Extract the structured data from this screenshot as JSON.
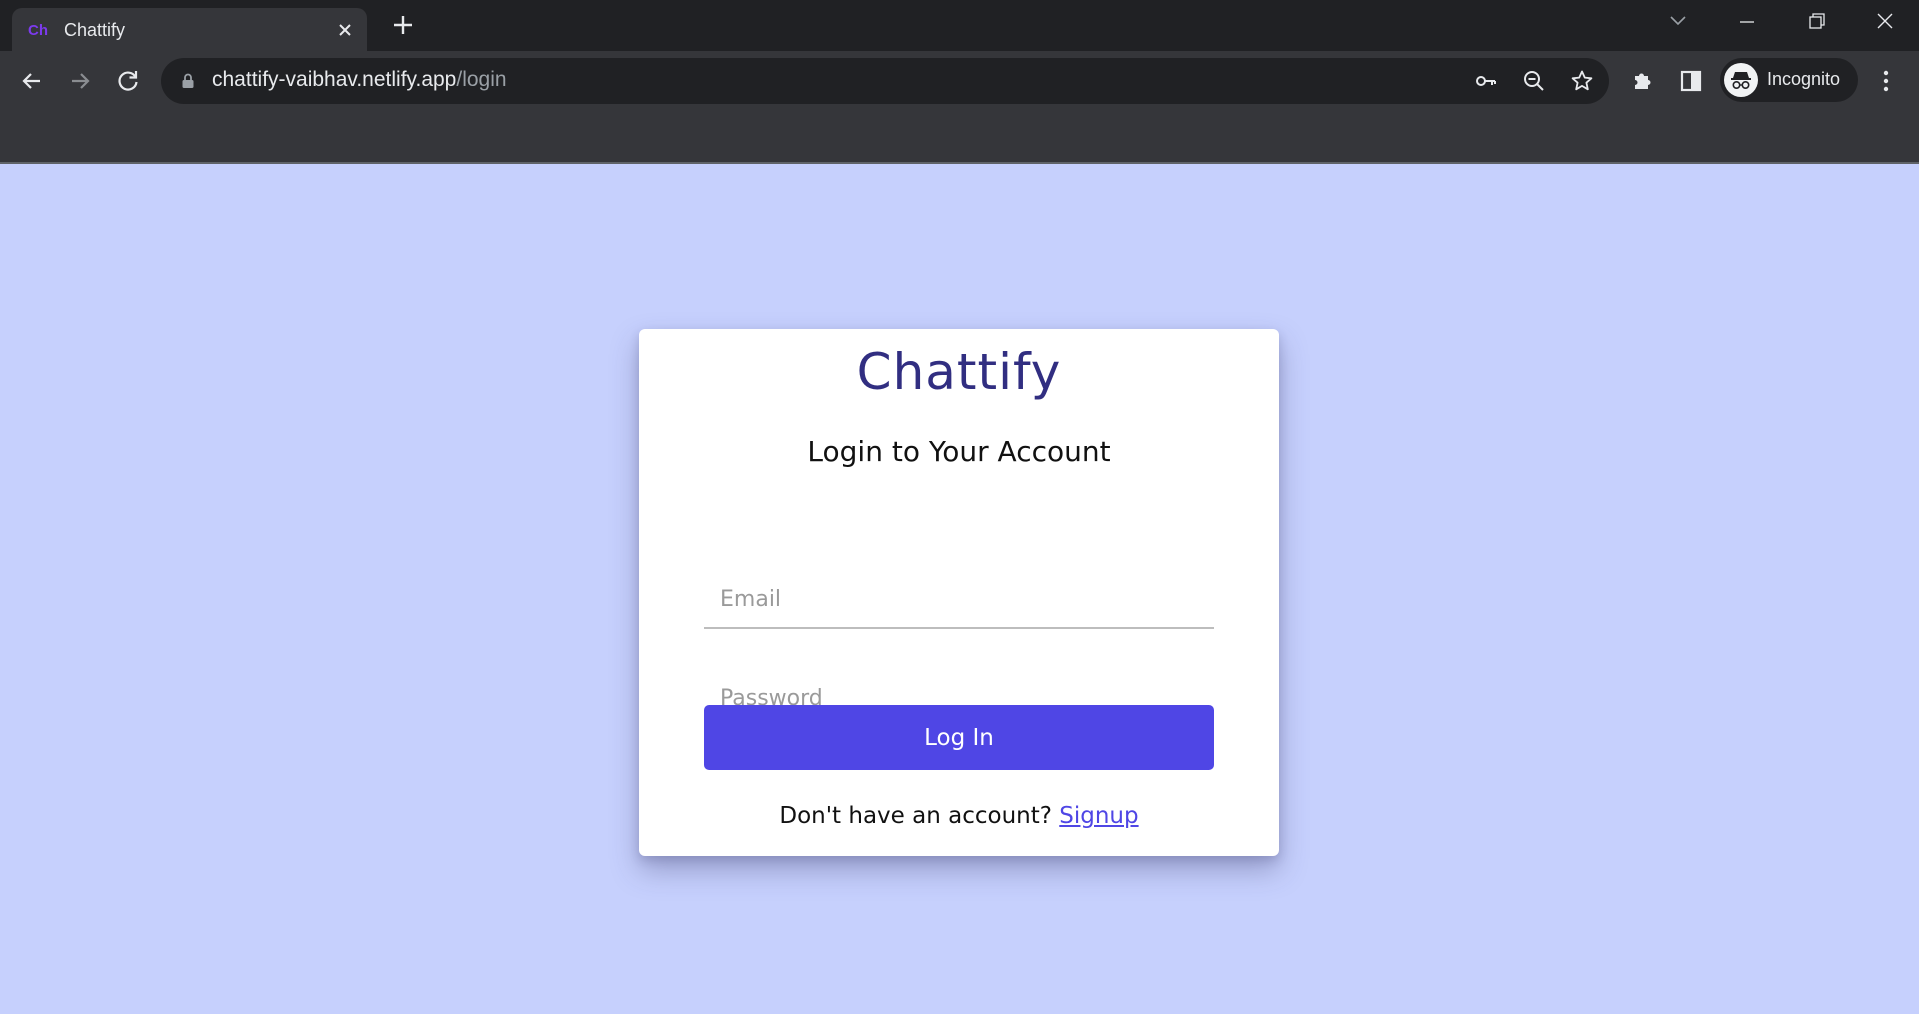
{
  "browser": {
    "tab": {
      "favicon_text": "Ch",
      "title": "Chattify"
    },
    "url": {
      "host": "chattify-vaibhav.netlify.app",
      "path": "/login"
    },
    "profile": {
      "label": "Incognito"
    },
    "icons": {
      "tab_close": "close-icon",
      "new_tab": "plus-icon",
      "back": "arrow-left-icon",
      "forward": "arrow-right-icon",
      "reload": "reload-icon",
      "lock": "lock-icon",
      "password": "key-icon",
      "zoom": "zoom-out-icon",
      "bookmark": "star-icon",
      "extensions": "puzzle-icon",
      "side_panel": "side-panel-icon",
      "menu": "kebab-menu-icon"
    }
  },
  "page": {
    "brand": "Chattify",
    "heading": "Login to Your Account",
    "email": {
      "placeholder": "Email",
      "value": ""
    },
    "password": {
      "placeholder": "Password",
      "value": ""
    },
    "login_button": "Log In",
    "signup_prompt": "Don't have an account?",
    "signup_link": "Signup"
  },
  "colors": {
    "page_background": "#c6d0fd",
    "brand": "#312e81",
    "primary_button": "#4f46e5",
    "link": "#4f46e5"
  }
}
